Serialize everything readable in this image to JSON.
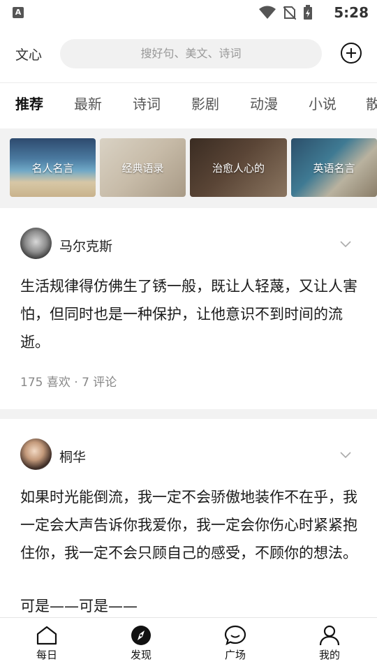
{
  "status_bar": {
    "time": "5:28",
    "app_icon": "A"
  },
  "header": {
    "logo": "文心",
    "search_placeholder": "搜好句、美文、诗词",
    "add_icon": "plus-circle-icon"
  },
  "tabs": [
    {
      "label": "推荐",
      "active": true
    },
    {
      "label": "最新"
    },
    {
      "label": "诗词"
    },
    {
      "label": "影剧"
    },
    {
      "label": "动漫"
    },
    {
      "label": "小说"
    },
    {
      "label": "散"
    }
  ],
  "banners": [
    {
      "label": "名人名言"
    },
    {
      "label": "经典语录"
    },
    {
      "label": "治愈人心的"
    },
    {
      "label": "英语名言"
    }
  ],
  "posts": [
    {
      "author": "马尔克斯",
      "text": "生活规律得仿佛生了锈一般，既让人轻蔑，又让人害怕，但同时也是一种保护，让他意识不到时间的流逝。",
      "likes": "175 喜欢",
      "separator": "·",
      "comments": "7 评论"
    },
    {
      "author": "桐华",
      "text": "如果时光能倒流，我一定不会骄傲地装作不在乎，我一定会大声告诉你我爱你，我一定会你伤心时紧紧抱住你，我一定不会只顾自己的感受，不顾你的想法。",
      "extra": "可是——可是——"
    }
  ],
  "bottom_nav": [
    {
      "label": "每日",
      "icon": "home-icon"
    },
    {
      "label": "发现",
      "icon": "compass-icon",
      "active": true
    },
    {
      "label": "广场",
      "icon": "chat-bubble-icon"
    },
    {
      "label": "我的",
      "icon": "person-icon"
    }
  ]
}
